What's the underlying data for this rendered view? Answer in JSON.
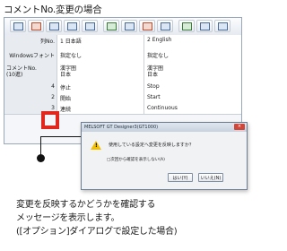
{
  "title": "コメントNo.変更の場合",
  "table": {
    "header": {
      "label": "列No.",
      "col1": "1 日本語",
      "col2": "2 English"
    },
    "window_font": {
      "label": "Windowsフォント",
      "col1": "指定なし",
      "col2": "指定なし"
    },
    "comment_no": {
      "label": "コメントNo.\n(10進)",
      "col1": "漢字圏\n日本",
      "col2": "漢字圏\n日本"
    },
    "rows": [
      {
        "no": "4",
        "col1": "停止",
        "col2": "Stop"
      },
      {
        "no": "2",
        "col1": "開始",
        "col2": "Start"
      },
      {
        "no": "3",
        "col1": "連続",
        "col2": "Continuous"
      }
    ]
  },
  "dialog": {
    "title": "MELSOFT GT Designer3(GT1000)",
    "close": "×",
    "message": "使用している設定へ変更を反映しますか？",
    "checkbox": "□次回から確認を表示しない(A)",
    "buttons": [
      "はい(Y)",
      "いいえ(N)"
    ]
  },
  "caption": [
    "変更を反映するかどうかを確認する",
    "メッセージを表示します。",
    "([オプション]ダイアログで設定した場合)"
  ]
}
